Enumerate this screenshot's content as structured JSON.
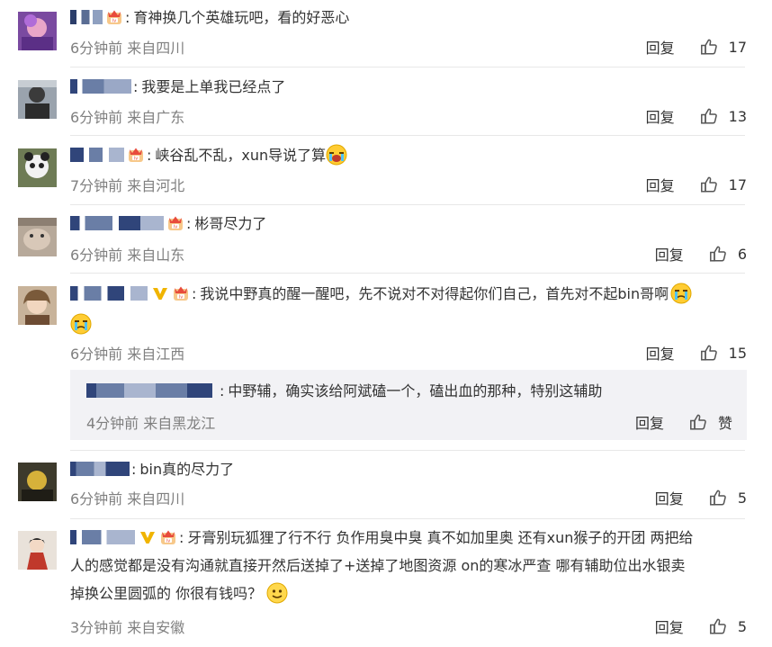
{
  "comments": [
    {
      "text": "育神换几个英雄玩吧，看的好恶心",
      "time": "6分钟前",
      "location": "来自四川",
      "reply_label": "回复",
      "likes": "17"
    },
    {
      "text": "我要是上单我已经点了",
      "time": "6分钟前",
      "location": "来自广东",
      "reply_label": "回复",
      "likes": "13"
    },
    {
      "text": "峡谷乱不乱，xun导说了算",
      "time": "7分钟前",
      "location": "来自河北",
      "reply_label": "回复",
      "likes": "17"
    },
    {
      "text": "彬哥尽力了",
      "time": "6分钟前",
      "location": "来自山东",
      "reply_label": "回复",
      "likes": "6"
    },
    {
      "text": "我说中野真的醒一醒吧，先不说对不对得起你们自己，首先对不起bin哥啊",
      "time": "6分钟前",
      "location": "来自江西",
      "reply_label": "回复",
      "likes": "15",
      "sub_reply": {
        "text": "中野辅，确实该给阿斌磕一个，磕出血的那种，特别这辅助",
        "time": "4分钟前",
        "location": "来自黑龙江",
        "reply_label": "回复",
        "like_label": "赞"
      }
    },
    {
      "text": "bin真的尽力了",
      "time": "6分钟前",
      "location": "来自四川",
      "reply_label": "回复",
      "likes": "5"
    },
    {
      "text_line1": "牙膏别玩狐狸了行不行 负作用臭中臭 真不如加里奥 还有xun猴子的开团 两把给",
      "text_line2": "人的感觉都是没有沟通就直接开然后送掉了+送掉了地图资源 on的寒冰严查 哪有辅助位出水银卖",
      "text_line3": "掉换公里圆弧的 你很有钱吗？",
      "time": "3分钟前",
      "location": "来自安徽",
      "reply_label": "回复",
      "likes": "5"
    }
  ],
  "colors": {
    "meta_text": "#808080",
    "divider": "#e8e8e8",
    "sub_reply_bg": "#f2f2f5",
    "verified_badge": "#f0b400",
    "crown_badge": "#e84b3c"
  }
}
